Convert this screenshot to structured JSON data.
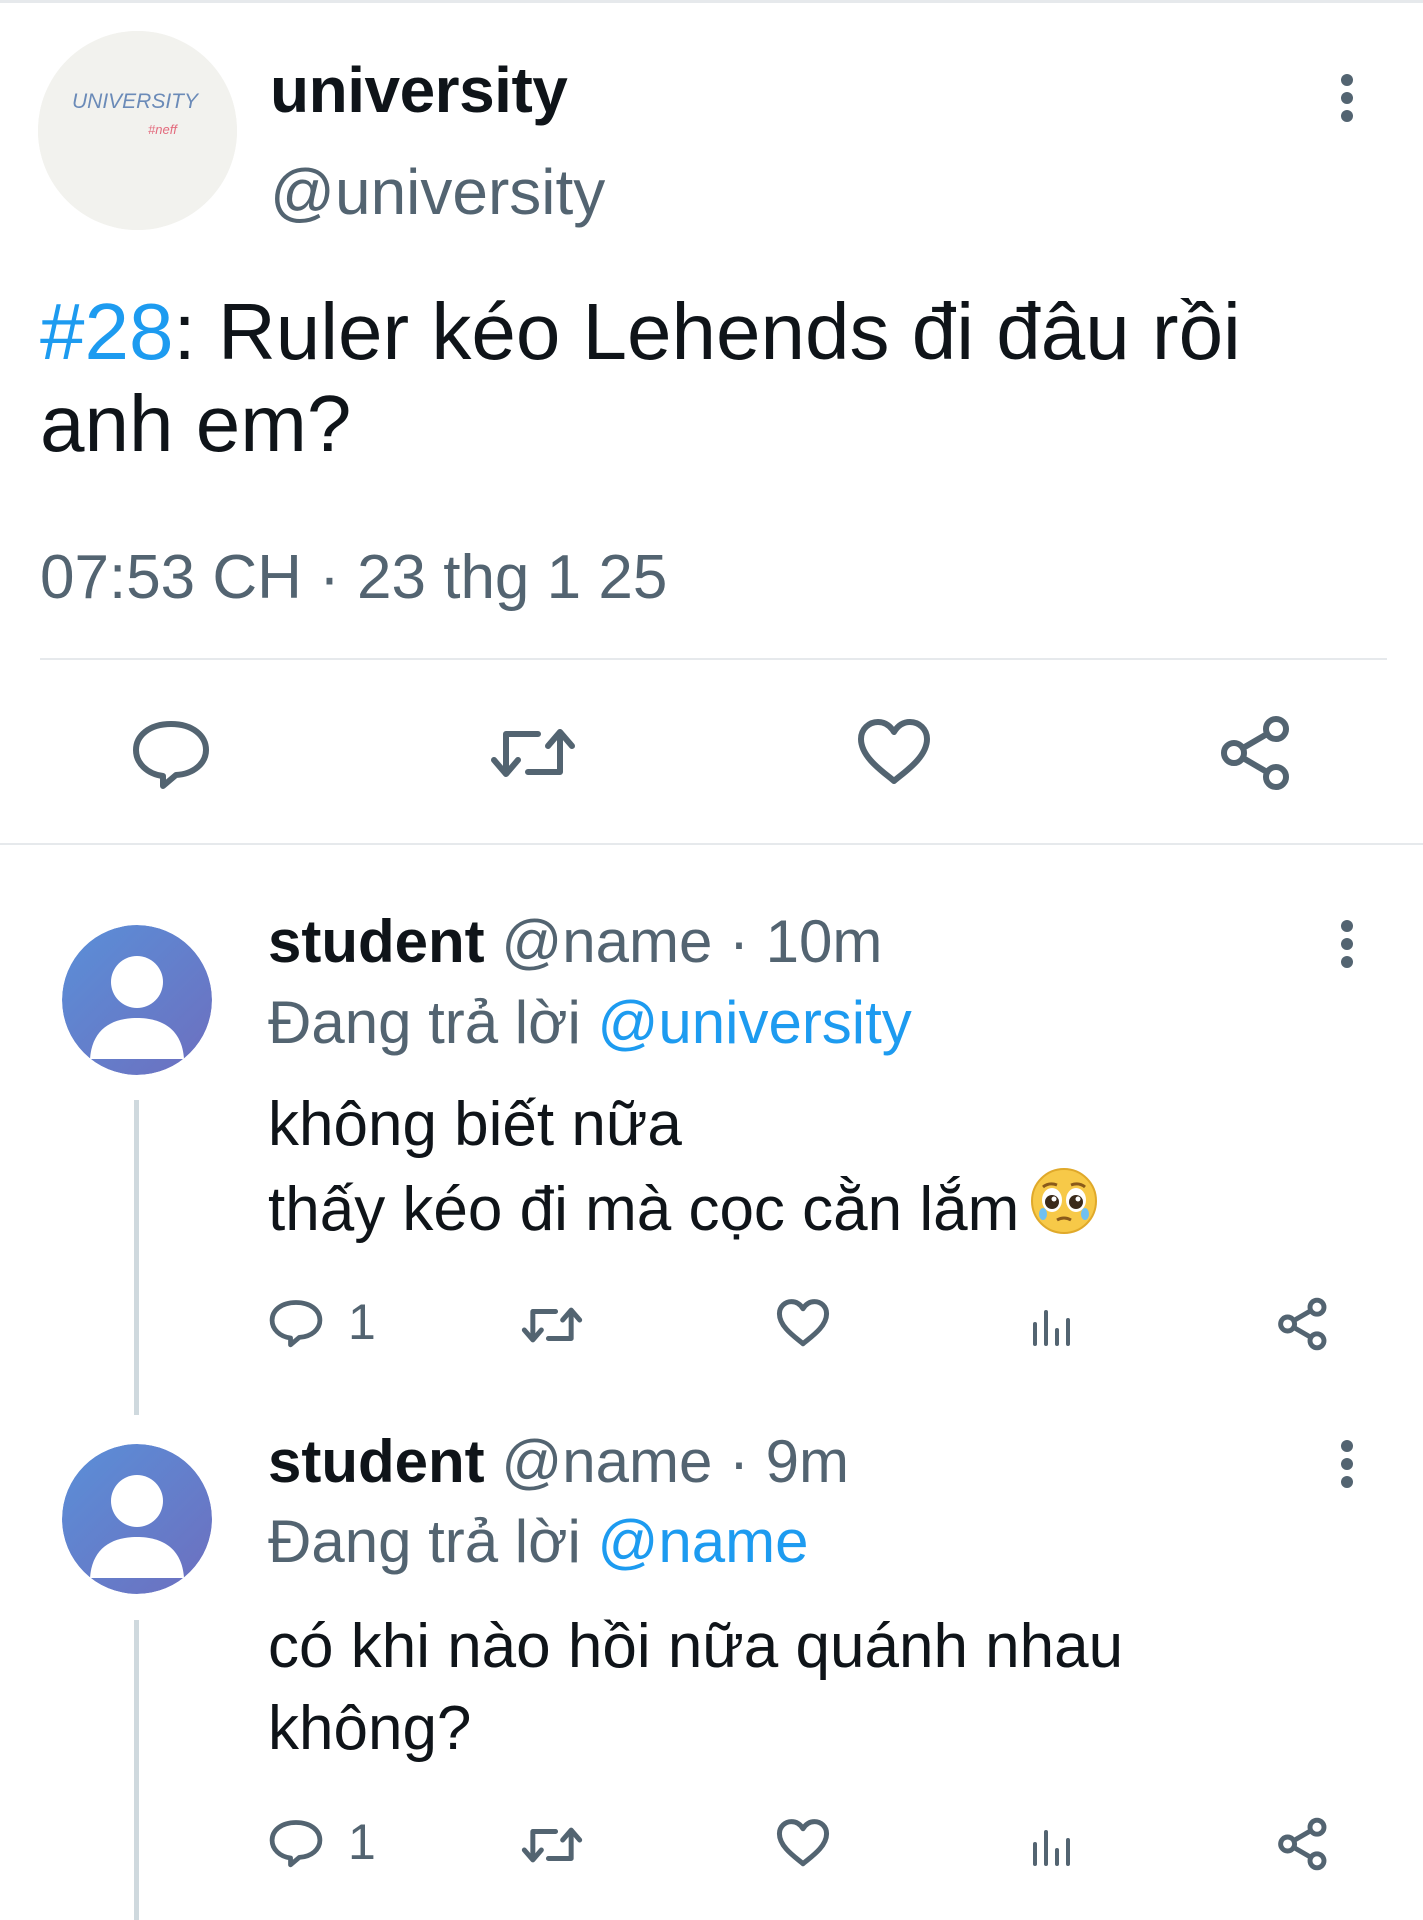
{
  "tweet": {
    "avatar_text": "UNIVERSITY",
    "avatar_sub": "#neff",
    "display_name": "university",
    "handle": "@university",
    "hashtag": "#28",
    "text_after_hashtag": ": Ruler kéo Lehends đi đâu rồi anh em?",
    "timestamp": "07:53 CH · 23 thg 1 25"
  },
  "replies": [
    {
      "display_name": "student",
      "handle": "@name",
      "sep": "·",
      "time": "10m",
      "replying_prefix": "Đang trả lời",
      "replying_to": "@university",
      "line1": "không biết nữa",
      "line2": "thấy kéo đi mà cọc cằn lắm",
      "reply_count": "1"
    },
    {
      "display_name": "student",
      "handle": "@name",
      "sep": "·",
      "time": "9m",
      "replying_prefix": "Đang trả lời",
      "replying_to": "@name",
      "line1": "có khi nào hồi nữa quánh nhau",
      "line2": "không?",
      "reply_count": "1"
    }
  ],
  "colors": {
    "accent": "#1d9bf0",
    "muted": "#536471",
    "text": "#0f1419",
    "divider": "#e6e9ec"
  }
}
